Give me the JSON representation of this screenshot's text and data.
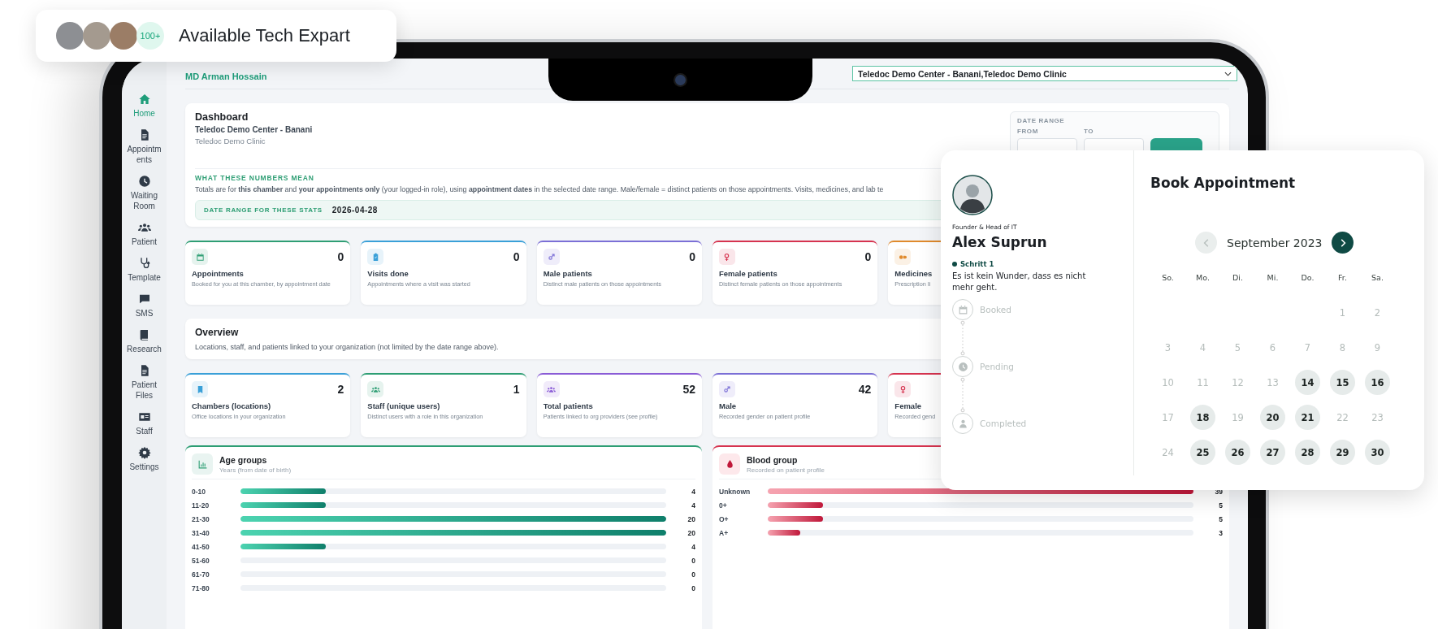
{
  "badge": {
    "count": "100+",
    "text": "Available Tech Expart"
  },
  "topbar": {
    "user": "MD Arman Hossain",
    "clinic_select": "Teledoc Demo Center - Banani,Teledoc Demo Clinic"
  },
  "sidebar": {
    "items": [
      {
        "label": "Home",
        "kind": "house",
        "selected": true
      },
      {
        "label": "Appointments",
        "kind": "document",
        "selected": false
      },
      {
        "label": "Waiting Room",
        "kind": "clock",
        "selected": false
      },
      {
        "label": "Patient",
        "kind": "people",
        "selected": false
      },
      {
        "label": "Template",
        "kind": "stethoscope",
        "selected": false
      },
      {
        "label": "SMS",
        "kind": "sms",
        "selected": false
      },
      {
        "label": "Research",
        "kind": "book",
        "selected": false
      },
      {
        "label": "Patient Files",
        "kind": "document",
        "selected": false
      },
      {
        "label": "Staff",
        "kind": "idcard",
        "selected": false
      },
      {
        "label": "Settings",
        "kind": "gear",
        "selected": false
      }
    ]
  },
  "dashboard": {
    "title": "Dashboard",
    "center": "Teledoc Demo Center - Banani",
    "clinic": "Teledoc Demo Clinic",
    "date_range": {
      "label": "DATE RANGE",
      "from_label": "FROM",
      "to_label": "TO"
    },
    "explain_heading": "WHAT THESE NUMBERS MEAN",
    "explain_text": "Totals are for **this chamber** and **your appointments only** (your logged-in role), using **appointment dates** in the selected date range. Male/female = distinct patients on those appointments. Visits, medicines, and lab te",
    "stats_range_label": "DATE RANGE FOR THESE STATS",
    "stats_range_value": "2026-04-28"
  },
  "stat_cards": [
    {
      "kind": "calendar",
      "label": "Appointments",
      "value": "0",
      "description": "Booked for you at this chamber, by appointment date",
      "color": "#2e9e74"
    },
    {
      "kind": "clipboard",
      "label": "Visits done",
      "value": "0",
      "description": "Appointments where a visit was started",
      "color": "#3aa0d8"
    },
    {
      "kind": "male",
      "label": "Male patients",
      "value": "0",
      "description": "Distinct male patients on those appointments",
      "color": "#7b6fd6"
    },
    {
      "kind": "female",
      "label": "Female patients",
      "value": "0",
      "description": "Distinct female patients on those appointments",
      "color": "#d6334f"
    },
    {
      "kind": "pills",
      "label": "Medicines",
      "description": "Prescription li",
      "color": "#e08a2c"
    }
  ],
  "overview": {
    "title": "Overview",
    "text": "Locations, staff, and patients linked to your organization (not limited by the date range above)."
  },
  "overview_cards": [
    {
      "kind": "bookmark",
      "label": "Chambers (locations)",
      "value": "2",
      "description": "Office locations in your organization",
      "color": "#3aa0d8"
    },
    {
      "kind": "people",
      "label": "Staff (unique users)",
      "value": "1",
      "description": "Distinct users with a role in this organization",
      "color": "#2e9e74"
    },
    {
      "kind": "people",
      "label": "Total patients",
      "value": "52",
      "description": "Patients linked to org providers (see profile)",
      "color": "#8a5cd6"
    },
    {
      "kind": "male",
      "label": "Male",
      "value": "42",
      "description": "Recorded gender on patient profile",
      "color": "#7b6fd6"
    },
    {
      "kind": "female",
      "label": "Female",
      "description": "Recorded gend",
      "color": "#d6334f"
    }
  ],
  "age_groups": {
    "title": "Age groups",
    "subtitle": "Years (from date of birth)",
    "rows": [
      {
        "label": "0-10",
        "count": "4",
        "level": 0.2
      },
      {
        "label": "11-20",
        "count": "4",
        "level": 0.2
      },
      {
        "label": "21-30",
        "count": "20",
        "level": 1
      },
      {
        "label": "31-40",
        "count": "20",
        "level": 1
      },
      {
        "label": "41-50",
        "count": "4",
        "level": 0.2
      },
      {
        "label": "51-60",
        "count": "0",
        "level": 0
      },
      {
        "label": "61-70",
        "count": "0",
        "level": 0
      },
      {
        "label": "71-80",
        "count": "0",
        "level": 0
      }
    ]
  },
  "blood_group": {
    "title": "Blood group",
    "subtitle": "Recorded on patient profile",
    "rows": [
      {
        "label": "Unknown",
        "count": "39",
        "level": 1
      },
      {
        "label": "0+",
        "count": "5",
        "level": 0.13
      },
      {
        "label": "O+",
        "count": "5",
        "level": 0.13
      },
      {
        "label": "A+",
        "count": "3",
        "level": 0.077
      }
    ]
  },
  "booking": {
    "role": "Founder & Head of IT",
    "name": "Alex Suprun",
    "step_label": "Schritt 1",
    "step_text": "Es ist kein Wunder, dass es nicht mehr geht.",
    "steps": [
      {
        "kind": "calendar",
        "label": "Booked"
      },
      {
        "kind": "clock",
        "label": "Pending"
      },
      {
        "kind": "person",
        "label": "Completed"
      }
    ],
    "title": "Book Appointment",
    "month": "September 2023",
    "weekdays": [
      "So.",
      "Mo.",
      "Di.",
      "Mi.",
      "Do.",
      "Fr.",
      "Sa."
    ],
    "weeks": [
      [
        {
          "label": "1",
          "available": false
        },
        {
          "label": "2",
          "available": false
        }
      ],
      [
        {
          "label": "3",
          "available": false
        },
        {
          "label": "4",
          "available": false
        },
        {
          "label": "5",
          "available": false
        },
        {
          "label": "6",
          "available": false
        },
        {
          "label": "7",
          "available": false
        },
        {
          "label": "8",
          "available": false
        },
        {
          "label": "9",
          "available": false
        }
      ],
      [
        {
          "label": "10",
          "available": false
        },
        {
          "label": "11",
          "available": false
        },
        {
          "label": "12",
          "available": false
        },
        {
          "label": "13",
          "available": false
        },
        {
          "label": "14",
          "available": true
        },
        {
          "label": "15",
          "available": true
        },
        {
          "label": "16",
          "available": true
        }
      ],
      [
        {
          "label": "17",
          "available": false
        },
        {
          "label": "18",
          "available": true
        },
        {
          "label": "19",
          "available": false
        },
        {
          "label": "20",
          "available": true
        },
        {
          "label": "21",
          "available": true
        },
        {
          "label": "22",
          "available": false
        },
        {
          "label": "23",
          "available": false
        }
      ],
      [
        {
          "label": "24",
          "available": false
        },
        {
          "label": "25",
          "available": true
        },
        {
          "label": "26",
          "available": true
        },
        {
          "label": "27",
          "available": true
        },
        {
          "label": "28",
          "available": true
        },
        {
          "label": "29",
          "available": true
        },
        {
          "label": "30",
          "available": true
        }
      ]
    ]
  }
}
